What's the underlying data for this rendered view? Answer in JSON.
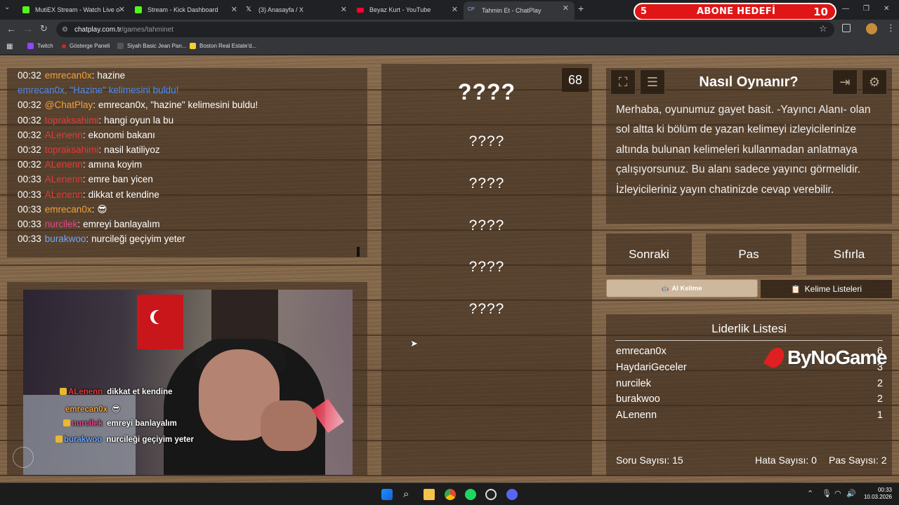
{
  "browser": {
    "tabs": [
      {
        "title": "MutiEX Stream - Watch Live on",
        "icon_color": "#53fc18",
        "active": false
      },
      {
        "title": "Stream - Kick Dashboard",
        "icon_color": "#53fc18",
        "active": false
      },
      {
        "title": "(3) Anasayfa / X",
        "icon_color": "#e7e9ea",
        "active": false
      },
      {
        "title": "Beyaz Kurt - YouTube",
        "icon_color": "#ff0033",
        "active": false
      },
      {
        "title": "Tahmin Et - ChatPlay",
        "icon_color": "#8ab4f8",
        "active": true
      }
    ],
    "url_host": "chatplay.com.tr",
    "url_path": "/games/tahminet",
    "bookmarks": [
      {
        "label": "Twitch",
        "icon_color": "#9146ff"
      },
      {
        "label": "Gösterge Paneli",
        "icon_color": "#c62828"
      },
      {
        "label": "Siyah Basic Jean Pan...",
        "icon_color": "#333333"
      },
      {
        "label": "Boston Real Estate'd...",
        "icon_color": "#f7d02c"
      }
    ]
  },
  "goal_widget": {
    "left_value": "5",
    "title": "ABONE HEDEFİ",
    "right_value": "10"
  },
  "chat": {
    "messages": [
      {
        "time": "00:32",
        "user": "emrecan0x",
        "user_color": "#f0a23a",
        "sep": ":",
        "text": "hazine",
        "text_color": "#ffffff"
      },
      {
        "time": "",
        "user": "emrecan0x, \"Hazine\" kelimesini buldu!",
        "user_color": "#4d8df6",
        "sep": "",
        "text": "",
        "text_color": "#4d8df6"
      },
      {
        "time": "00:32",
        "user": "@ChatPlay",
        "user_color": "#f0a23a",
        "sep": ":",
        "text": "emrecan0x, \"hazine\" kelimesini buldu!",
        "text_color": "#ffffff"
      },
      {
        "time": "00:32",
        "user": "topraksahimi",
        "user_color": "#e23a3a",
        "sep": ":",
        "text": "hangi oyun la bu",
        "text_color": "#ffffff"
      },
      {
        "time": "00:32",
        "user": "ALenenn",
        "user_color": "#e23a3a",
        "sep": ":",
        "text": "ekonomi bakanı",
        "text_color": "#ffffff"
      },
      {
        "time": "00:32",
        "user": "topraksahimi",
        "user_color": "#e23a3a",
        "sep": ":",
        "text": "nasil katiliyoz",
        "text_color": "#ffffff"
      },
      {
        "time": "00:32",
        "user": "ALenenn",
        "user_color": "#e23a3a",
        "sep": ":",
        "text": "amına koyim",
        "text_color": "#ffffff"
      },
      {
        "time": "00:33",
        "user": "ALenenn",
        "user_color": "#e23a3a",
        "sep": ":",
        "text": "emre ban yicen",
        "text_color": "#ffffff"
      },
      {
        "time": "00:33",
        "user": "ALenenn",
        "user_color": "#e23a3a",
        "sep": ":",
        "text": "dikkat et kendine",
        "text_color": "#ffffff"
      },
      {
        "time": "00:33",
        "user": "emrecan0x",
        "user_color": "#f0a23a",
        "sep": ":",
        "text": "😎",
        "text_color": "#ffffff"
      },
      {
        "time": "00:33",
        "user": "nurcilek",
        "user_color": "#e24a8a",
        "sep": ":",
        "text": "emreyi banlayalım",
        "text_color": "#ffffff"
      },
      {
        "time": "00:33",
        "user": "burakwoo",
        "user_color": "#6fa8ff",
        "sep": ":",
        "text": "nurcileği geçiyim yeter",
        "text_color": "#ffffff"
      }
    ]
  },
  "stream_overlay": [
    {
      "user": "ALenenn",
      "user_color": "#e23a3a",
      "text": "dikkat et kendine"
    },
    {
      "user": "emrecan0x",
      "user_color": "#f0a23a",
      "text": "😎"
    },
    {
      "user": "nurcilek",
      "user_color": "#e24a8a",
      "text": "emreyi banlayalım"
    },
    {
      "user": "burakwoo",
      "user_color": "#6fa8ff",
      "text": "nurcileği geçiyim yeter"
    }
  ],
  "game": {
    "timer": "68",
    "main_word": "????",
    "forbidden_words": [
      "????",
      "????",
      "????",
      "????",
      "????"
    ]
  },
  "how_to_play": {
    "title": "Nasıl Oynanır?",
    "text": "Merhaba, oyunumuz gayet basit. -Yayıncı Alanı- olan sol altta ki bölüm de yazan kelimeyi izleyicilerinize altında bulunan kelimeleri kullanmadan anlatmaya çalışıyorsunuz. Bu alanı sadece yayıncı görmelidir. İzleyicileriniz yayın chatinizde cevap verebilir."
  },
  "actions": {
    "next": "Sonraki",
    "pass": "Pas",
    "reset": "Sıfırla",
    "ai_word": "AI Kelime",
    "word_lists": "Kelime Listeleri"
  },
  "leaderboard": {
    "title": "Liderlik Listesi",
    "rows": [
      {
        "name": "emrecan0x",
        "score": "6"
      },
      {
        "name": "HaydariGeceler",
        "score": "3"
      },
      {
        "name": "nurcilek",
        "score": "2"
      },
      {
        "name": "burakwoo",
        "score": "2"
      },
      {
        "name": "ALenenn",
        "score": "1"
      }
    ]
  },
  "stats": {
    "questions": "Soru Sayısı: 15",
    "errors": "Hata Sayısı: 0",
    "passes": "Pas Sayısı: 2"
  },
  "watermark": "ByNoGame",
  "taskbar": {
    "time": "00:33",
    "date": "10.03.2026"
  }
}
